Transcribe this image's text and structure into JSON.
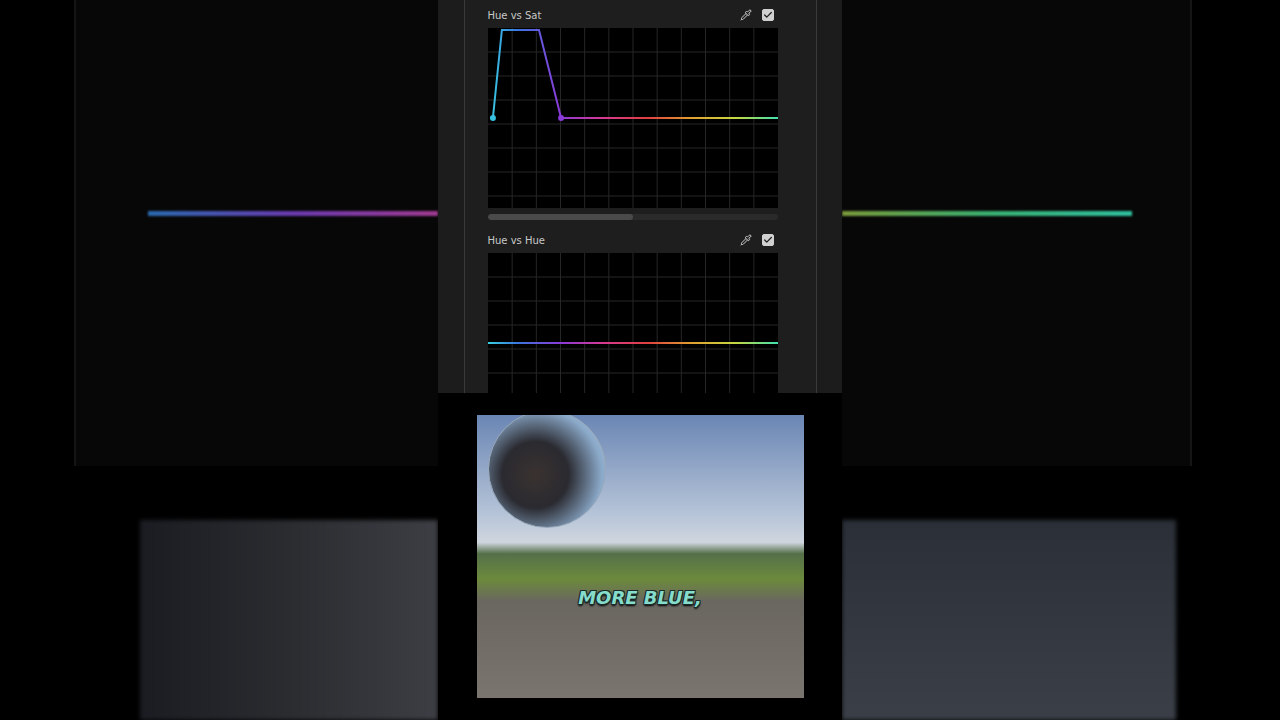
{
  "curve_panels": [
    {
      "title": "Hue vs Sat",
      "enabled": true,
      "points": [
        {
          "x": 0.017,
          "y": 0,
          "handle": true
        },
        {
          "x": 0.048,
          "y": 0.99,
          "handle": false
        },
        {
          "x": 0.176,
          "y": 0.99,
          "handle": false
        },
        {
          "x": 0.252,
          "y": 0,
          "handle": true
        },
        {
          "x": 1,
          "y": 0,
          "handle": false
        }
      ],
      "scrollbar": {
        "level": 0.5
      }
    },
    {
      "title": "Hue vs Hue",
      "enabled": true,
      "points": [
        {
          "x": 0,
          "y": 0,
          "handle": false
        },
        {
          "x": 1,
          "y": 0,
          "handle": false
        }
      ]
    }
  ],
  "video": {
    "caption": "MORE BLUE,"
  }
}
